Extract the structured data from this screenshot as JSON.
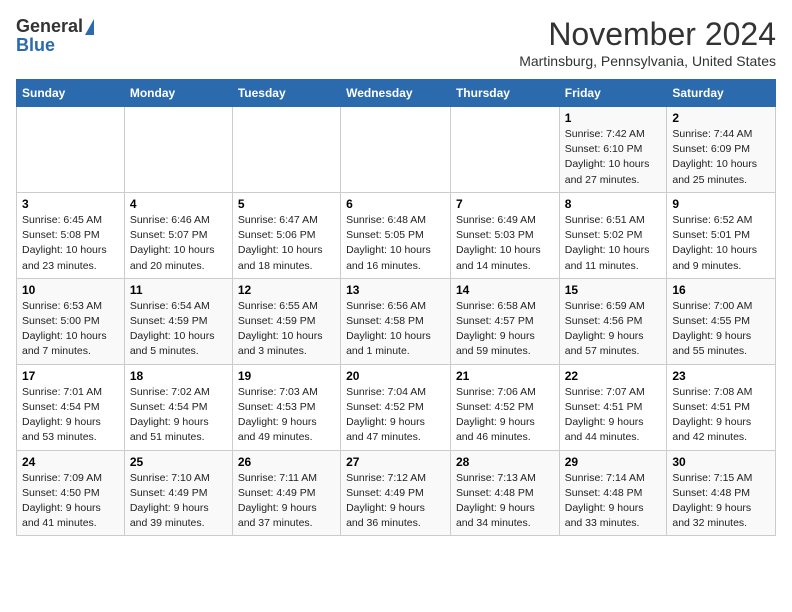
{
  "header": {
    "logo_general": "General",
    "logo_blue": "Blue",
    "month_title": "November 2024",
    "location": "Martinsburg, Pennsylvania, United States"
  },
  "days_of_week": [
    "Sunday",
    "Monday",
    "Tuesday",
    "Wednesday",
    "Thursday",
    "Friday",
    "Saturday"
  ],
  "weeks": [
    [
      {
        "day": "",
        "info": ""
      },
      {
        "day": "",
        "info": ""
      },
      {
        "day": "",
        "info": ""
      },
      {
        "day": "",
        "info": ""
      },
      {
        "day": "",
        "info": ""
      },
      {
        "day": "1",
        "info": "Sunrise: 7:42 AM\nSunset: 6:10 PM\nDaylight: 10 hours\nand 27 minutes."
      },
      {
        "day": "2",
        "info": "Sunrise: 7:44 AM\nSunset: 6:09 PM\nDaylight: 10 hours\nand 25 minutes."
      }
    ],
    [
      {
        "day": "3",
        "info": "Sunrise: 6:45 AM\nSunset: 5:08 PM\nDaylight: 10 hours\nand 23 minutes."
      },
      {
        "day": "4",
        "info": "Sunrise: 6:46 AM\nSunset: 5:07 PM\nDaylight: 10 hours\nand 20 minutes."
      },
      {
        "day": "5",
        "info": "Sunrise: 6:47 AM\nSunset: 5:06 PM\nDaylight: 10 hours\nand 18 minutes."
      },
      {
        "day": "6",
        "info": "Sunrise: 6:48 AM\nSunset: 5:05 PM\nDaylight: 10 hours\nand 16 minutes."
      },
      {
        "day": "7",
        "info": "Sunrise: 6:49 AM\nSunset: 5:03 PM\nDaylight: 10 hours\nand 14 minutes."
      },
      {
        "day": "8",
        "info": "Sunrise: 6:51 AM\nSunset: 5:02 PM\nDaylight: 10 hours\nand 11 minutes."
      },
      {
        "day": "9",
        "info": "Sunrise: 6:52 AM\nSunset: 5:01 PM\nDaylight: 10 hours\nand 9 minutes."
      }
    ],
    [
      {
        "day": "10",
        "info": "Sunrise: 6:53 AM\nSunset: 5:00 PM\nDaylight: 10 hours\nand 7 minutes."
      },
      {
        "day": "11",
        "info": "Sunrise: 6:54 AM\nSunset: 4:59 PM\nDaylight: 10 hours\nand 5 minutes."
      },
      {
        "day": "12",
        "info": "Sunrise: 6:55 AM\nSunset: 4:59 PM\nDaylight: 10 hours\nand 3 minutes."
      },
      {
        "day": "13",
        "info": "Sunrise: 6:56 AM\nSunset: 4:58 PM\nDaylight: 10 hours\nand 1 minute."
      },
      {
        "day": "14",
        "info": "Sunrise: 6:58 AM\nSunset: 4:57 PM\nDaylight: 9 hours\nand 59 minutes."
      },
      {
        "day": "15",
        "info": "Sunrise: 6:59 AM\nSunset: 4:56 PM\nDaylight: 9 hours\nand 57 minutes."
      },
      {
        "day": "16",
        "info": "Sunrise: 7:00 AM\nSunset: 4:55 PM\nDaylight: 9 hours\nand 55 minutes."
      }
    ],
    [
      {
        "day": "17",
        "info": "Sunrise: 7:01 AM\nSunset: 4:54 PM\nDaylight: 9 hours\nand 53 minutes."
      },
      {
        "day": "18",
        "info": "Sunrise: 7:02 AM\nSunset: 4:54 PM\nDaylight: 9 hours\nand 51 minutes."
      },
      {
        "day": "19",
        "info": "Sunrise: 7:03 AM\nSunset: 4:53 PM\nDaylight: 9 hours\nand 49 minutes."
      },
      {
        "day": "20",
        "info": "Sunrise: 7:04 AM\nSunset: 4:52 PM\nDaylight: 9 hours\nand 47 minutes."
      },
      {
        "day": "21",
        "info": "Sunrise: 7:06 AM\nSunset: 4:52 PM\nDaylight: 9 hours\nand 46 minutes."
      },
      {
        "day": "22",
        "info": "Sunrise: 7:07 AM\nSunset: 4:51 PM\nDaylight: 9 hours\nand 44 minutes."
      },
      {
        "day": "23",
        "info": "Sunrise: 7:08 AM\nSunset: 4:51 PM\nDaylight: 9 hours\nand 42 minutes."
      }
    ],
    [
      {
        "day": "24",
        "info": "Sunrise: 7:09 AM\nSunset: 4:50 PM\nDaylight: 9 hours\nand 41 minutes."
      },
      {
        "day": "25",
        "info": "Sunrise: 7:10 AM\nSunset: 4:49 PM\nDaylight: 9 hours\nand 39 minutes."
      },
      {
        "day": "26",
        "info": "Sunrise: 7:11 AM\nSunset: 4:49 PM\nDaylight: 9 hours\nand 37 minutes."
      },
      {
        "day": "27",
        "info": "Sunrise: 7:12 AM\nSunset: 4:49 PM\nDaylight: 9 hours\nand 36 minutes."
      },
      {
        "day": "28",
        "info": "Sunrise: 7:13 AM\nSunset: 4:48 PM\nDaylight: 9 hours\nand 34 minutes."
      },
      {
        "day": "29",
        "info": "Sunrise: 7:14 AM\nSunset: 4:48 PM\nDaylight: 9 hours\nand 33 minutes."
      },
      {
        "day": "30",
        "info": "Sunrise: 7:15 AM\nSunset: 4:48 PM\nDaylight: 9 hours\nand 32 minutes."
      }
    ]
  ]
}
